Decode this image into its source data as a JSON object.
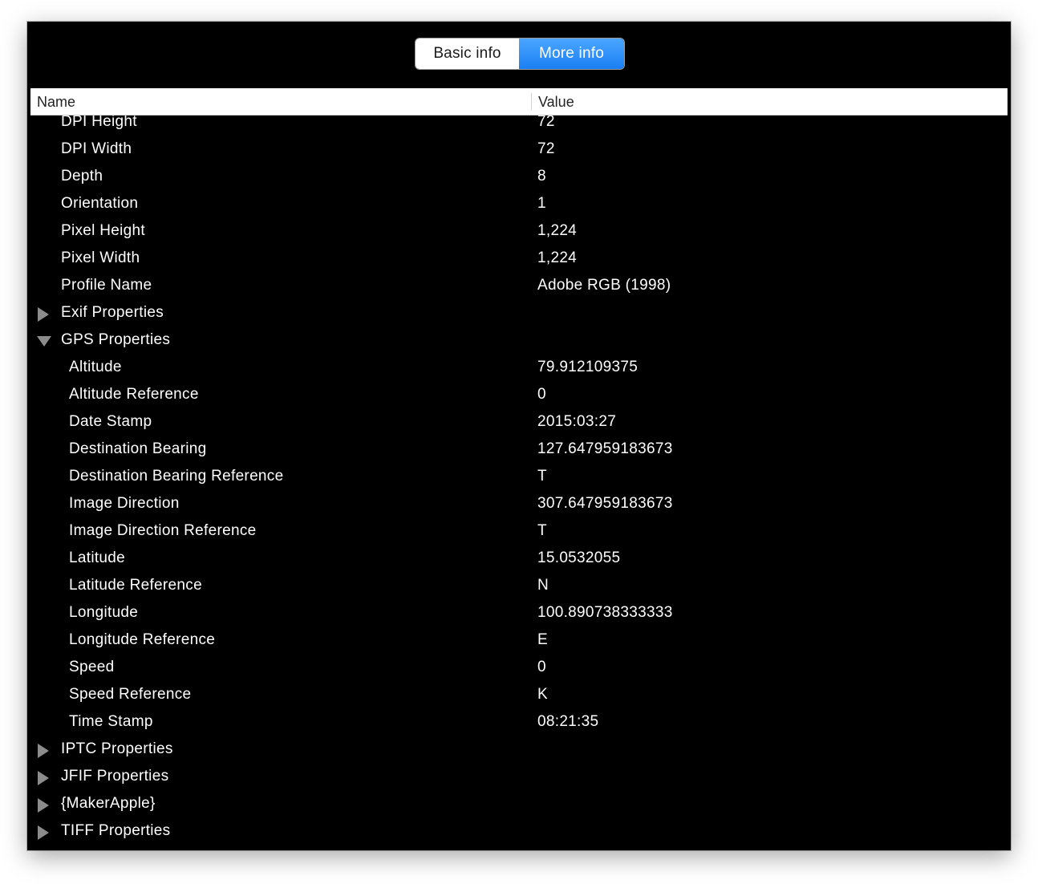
{
  "tabs": {
    "basic_label": "Basic info",
    "more_label": "More info",
    "selected": "More info"
  },
  "columns": {
    "name": "Name",
    "value": "Value"
  },
  "colors": {
    "window_bg": "#000000",
    "row_text": "#ffffff",
    "accent": "#1a7ff3",
    "disclosure": "#8c8c8c"
  },
  "icons": {
    "collapsed": "triangle-right-icon",
    "expanded": "triangle-down-icon"
  },
  "rows": [
    {
      "name": "DPI Height",
      "value": "72",
      "level": 0
    },
    {
      "name": "DPI Width",
      "value": "72",
      "level": 0
    },
    {
      "name": "Depth",
      "value": "8",
      "level": 0
    },
    {
      "name": "Orientation",
      "value": "1",
      "level": 0
    },
    {
      "name": "Pixel Height",
      "value": "1,224",
      "level": 0
    },
    {
      "name": "Pixel Width",
      "value": "1,224",
      "level": 0
    },
    {
      "name": "Profile Name",
      "value": "Adobe RGB (1998)",
      "level": 0
    },
    {
      "name": "Exif Properties",
      "value": "",
      "level": 0,
      "group": "collapsed"
    },
    {
      "name": "GPS Properties",
      "value": "",
      "level": 0,
      "group": "expanded"
    },
    {
      "name": "Altitude",
      "value": "79.912109375",
      "level": 1
    },
    {
      "name": "Altitude Reference",
      "value": "0",
      "level": 1
    },
    {
      "name": "Date Stamp",
      "value": "2015:03:27",
      "level": 1
    },
    {
      "name": "Destination Bearing",
      "value": "127.647959183673",
      "level": 1
    },
    {
      "name": "Destination Bearing Reference",
      "value": "T",
      "level": 1
    },
    {
      "name": "Image Direction",
      "value": "307.647959183673",
      "level": 1
    },
    {
      "name": "Image Direction Reference",
      "value": "T",
      "level": 1
    },
    {
      "name": "Latitude",
      "value": "15.0532055",
      "level": 1
    },
    {
      "name": "Latitude Reference",
      "value": "N",
      "level": 1
    },
    {
      "name": "Longitude",
      "value": "100.890738333333",
      "level": 1
    },
    {
      "name": "Longitude Reference",
      "value": "E",
      "level": 1
    },
    {
      "name": "Speed",
      "value": "0",
      "level": 1
    },
    {
      "name": "Speed Reference",
      "value": "K",
      "level": 1
    },
    {
      "name": "Time Stamp",
      "value": "08:21:35",
      "level": 1
    },
    {
      "name": "IPTC Properties",
      "value": "",
      "level": 0,
      "group": "collapsed"
    },
    {
      "name": "JFIF Properties",
      "value": "",
      "level": 0,
      "group": "collapsed"
    },
    {
      "name": "{MakerApple}",
      "value": "",
      "level": 0,
      "group": "collapsed"
    },
    {
      "name": "TIFF Properties",
      "value": "",
      "level": 0,
      "group": "collapsed"
    }
  ]
}
